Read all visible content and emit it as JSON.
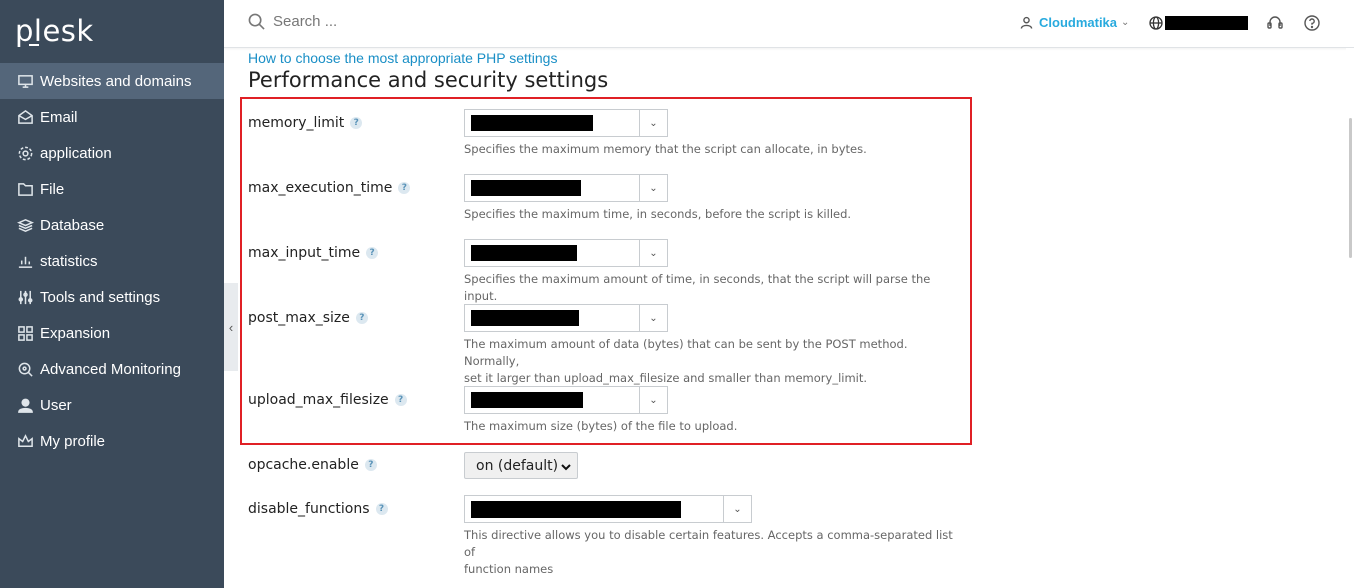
{
  "brand": {
    "logo_text": "plesk"
  },
  "sidebar": {
    "items": [
      {
        "label": "Websites and domains",
        "icon": "monitor-icon",
        "active": true
      },
      {
        "label": "Email",
        "icon": "envelope-icon"
      },
      {
        "label": "application",
        "icon": "gear-icon"
      },
      {
        "label": "File",
        "icon": "file-icon"
      },
      {
        "label": "Database",
        "icon": "database-icon"
      },
      {
        "label": "statistics",
        "icon": "bar-chart-icon"
      },
      {
        "label": "Tools and settings",
        "icon": "sliders-icon"
      },
      {
        "label": "Expansion",
        "icon": "grid-icon"
      },
      {
        "label": "Advanced Monitoring",
        "icon": "magnifier-icon"
      },
      {
        "label": "User",
        "icon": "user-icon"
      },
      {
        "label": "My profile",
        "icon": "crown-icon"
      }
    ]
  },
  "header": {
    "search_placeholder": "Search ...",
    "user_name": "Cloudmatika"
  },
  "page": {
    "help_link": "How to choose the most appropriate PHP settings",
    "section_title": "Performance and security settings"
  },
  "settings": [
    {
      "label": "memory_limit",
      "hint": "Specifies the maximum memory that the script can allocate, in bytes."
    },
    {
      "label": "max_execution_time",
      "hint": "Specifies the maximum time, in seconds, before the script is killed."
    },
    {
      "label": "max_input_time",
      "hint": "Specifies the maximum amount of time, in seconds, that the script will parse the input."
    },
    {
      "label": "post_max_size",
      "hint_line1": "The maximum amount of data (bytes) that can be sent by the POST method. Normally,",
      "hint_line2": "set it larger than upload_max_filesize and smaller than memory_limit."
    },
    {
      "label": "upload_max_filesize",
      "hint": "The maximum size (bytes) of the file to upload."
    },
    {
      "label": "opcache.enable",
      "value": "on (default)"
    },
    {
      "label": "disable_functions",
      "hint_line1": "This directive allows you to disable certain features. Accepts a comma-separated list of",
      "hint_line2": "function names"
    }
  ],
  "colors": {
    "sidebar": "#3b4a5a",
    "accent": "#28aade",
    "highlight": "#e02025",
    "link": "#1a8fc6"
  }
}
